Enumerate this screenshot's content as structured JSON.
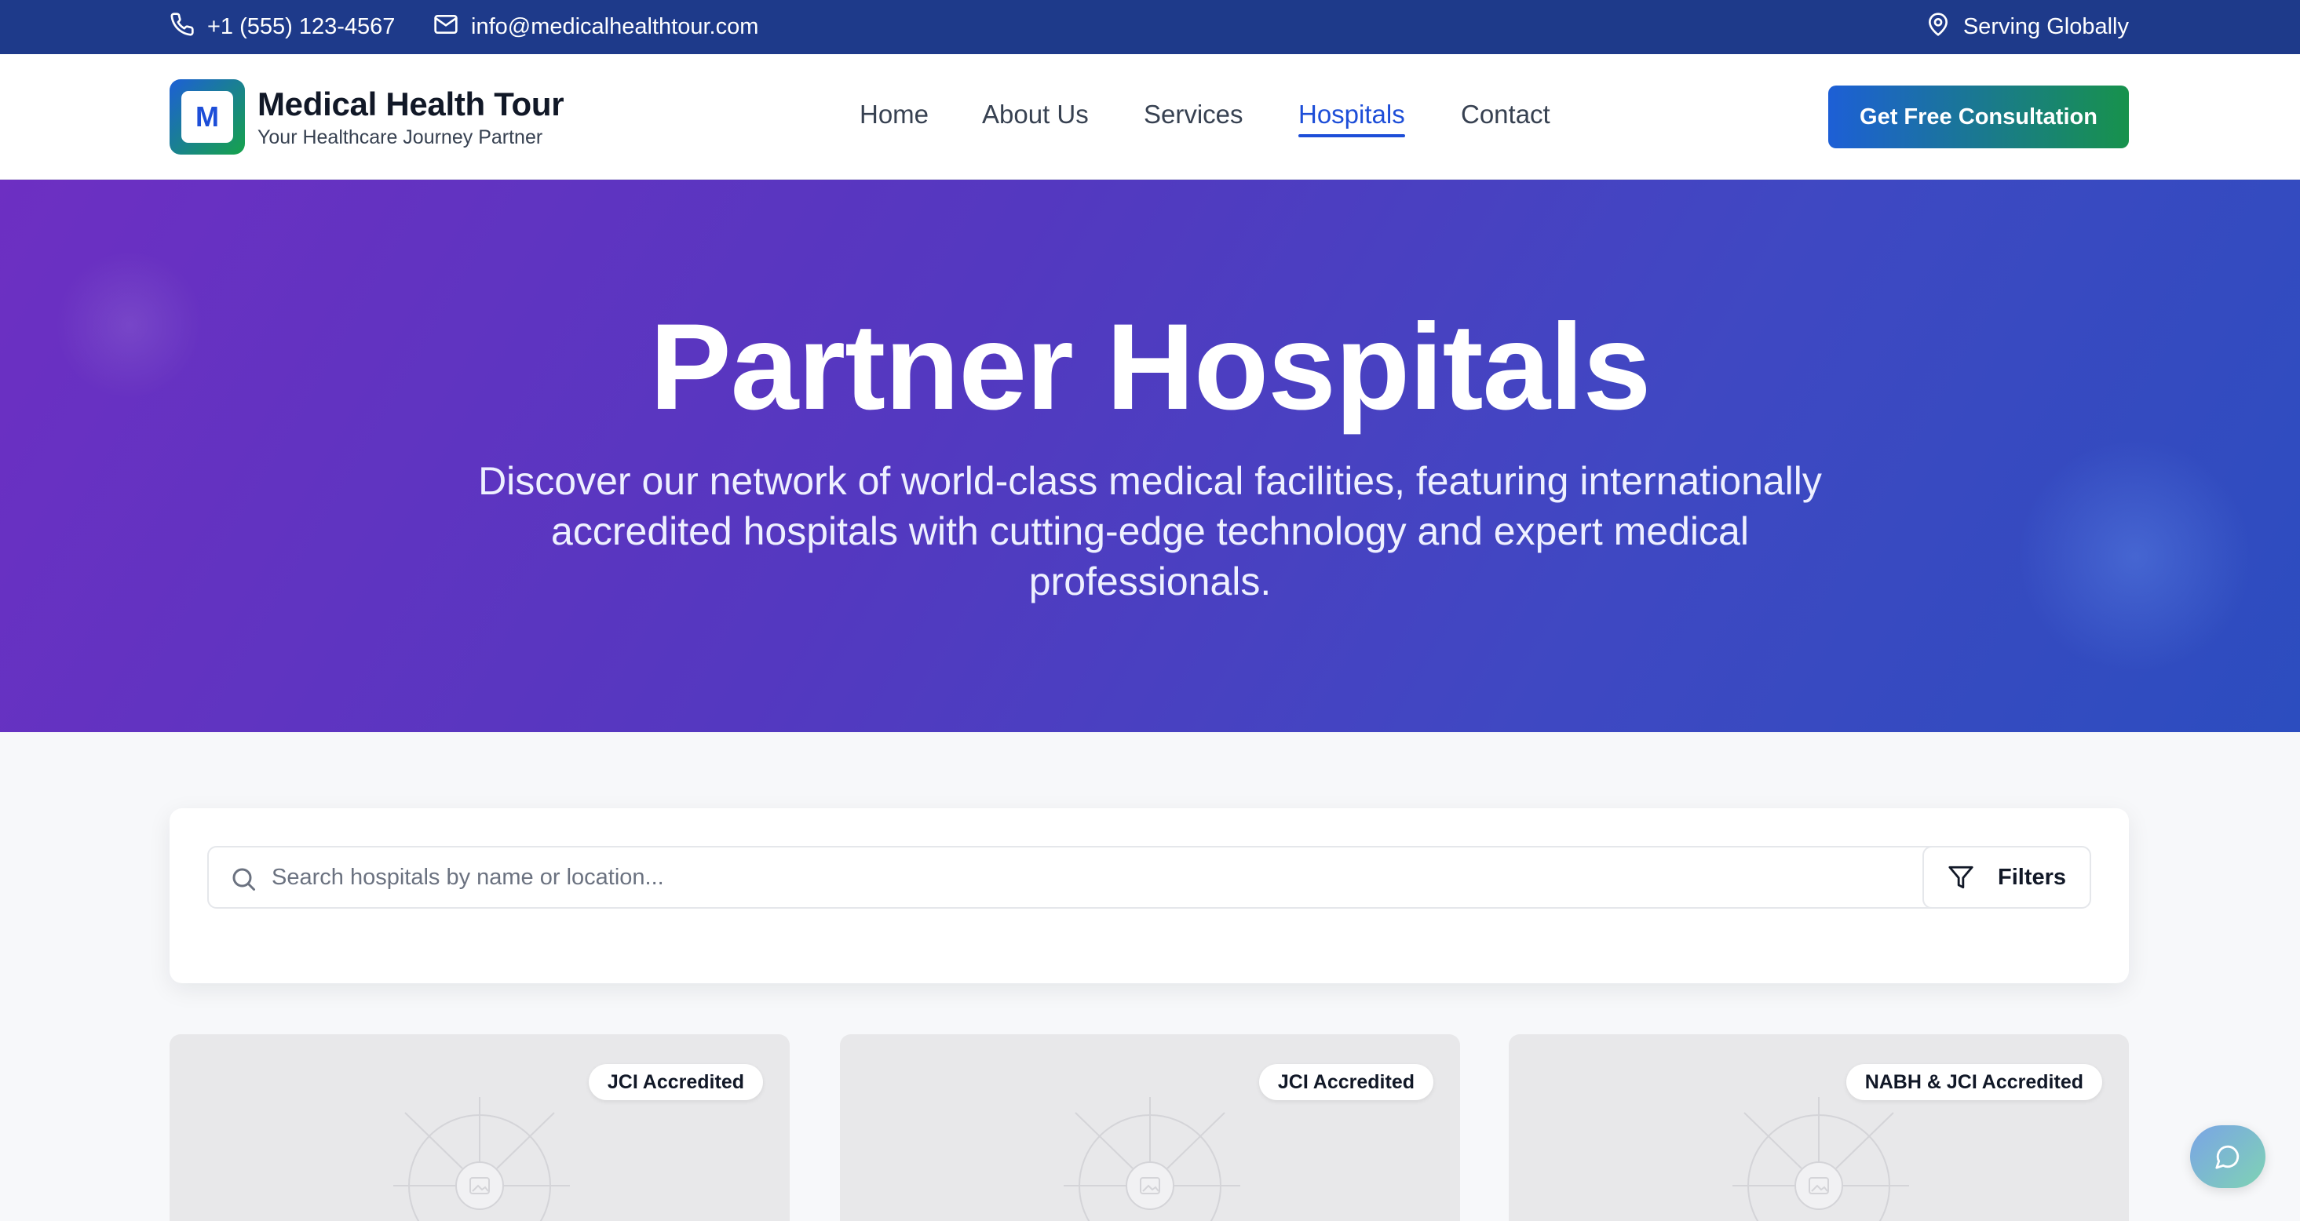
{
  "topbar": {
    "phone": "+1 (555) 123-4567",
    "email": "info@medicalhealthtour.com",
    "location": "Serving Globally"
  },
  "brand": {
    "logo_letter": "M",
    "title": "Medical Health Tour",
    "subtitle": "Your Healthcare Journey Partner"
  },
  "nav": {
    "items": [
      {
        "label": "Home"
      },
      {
        "label": "About Us"
      },
      {
        "label": "Services"
      },
      {
        "label": "Hospitals",
        "active": true
      },
      {
        "label": "Contact"
      }
    ],
    "cta": "Get Free Consultation"
  },
  "hero": {
    "title": "Partner Hospitals",
    "description": "Discover our network of world-class medical facilities, featuring internationally accredited hospitals with cutting-edge technology and expert medical professionals."
  },
  "search": {
    "placeholder": "Search hospitals by name or location...",
    "value": "",
    "filters_label": "Filters"
  },
  "cards": [
    {
      "badge": "JCI Accredited"
    },
    {
      "badge": "JCI Accredited"
    },
    {
      "badge": "NABH & JCI Accredited"
    }
  ],
  "colors": {
    "topbar": "#1e3a8a",
    "accent": "#1d4ed8",
    "hero_start": "#6d2fc2",
    "hero_end": "#2c4dbf",
    "cta_start": "#1d5fd6",
    "cta_end": "#17924c"
  }
}
